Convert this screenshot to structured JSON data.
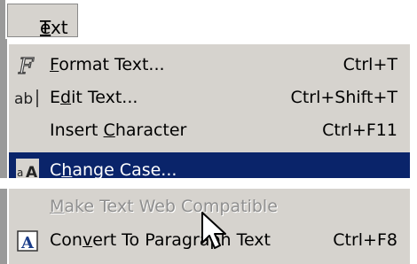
{
  "menu": {
    "title": "Text",
    "title_mnemonic": "T",
    "title_rest": "ext",
    "items": [
      {
        "pre": "",
        "mn": "F",
        "post": "ormat Text...",
        "shortcut": "Ctrl+T",
        "icon": "format-text-icon",
        "state": "normal"
      },
      {
        "pre": "E",
        "mn": "d",
        "post": "it Text...",
        "shortcut": "Ctrl+Shift+T",
        "icon": "edit-text-icon",
        "state": "normal"
      },
      {
        "pre": "Insert ",
        "mn": "C",
        "post": "haracter",
        "shortcut": "Ctrl+F11",
        "icon": "",
        "state": "normal"
      },
      {
        "pre": "C",
        "mn": "h",
        "post": "ange Case...",
        "shortcut": "",
        "icon": "change-case-icon",
        "state": "selected"
      },
      {
        "pre": "",
        "mn": "M",
        "post": "ake Text Web Compatible",
        "shortcut": "",
        "icon": "",
        "state": "disabled"
      },
      {
        "pre": "Con",
        "mn": "v",
        "post": "ert To Paragraph Text",
        "shortcut": "Ctrl+F8",
        "icon": "convert-paragraph-icon",
        "state": "normal"
      }
    ]
  },
  "colors": {
    "menu_background": "#d6d3ce",
    "selection": "#0a246a",
    "disabled_text": "#8f8f8f"
  }
}
